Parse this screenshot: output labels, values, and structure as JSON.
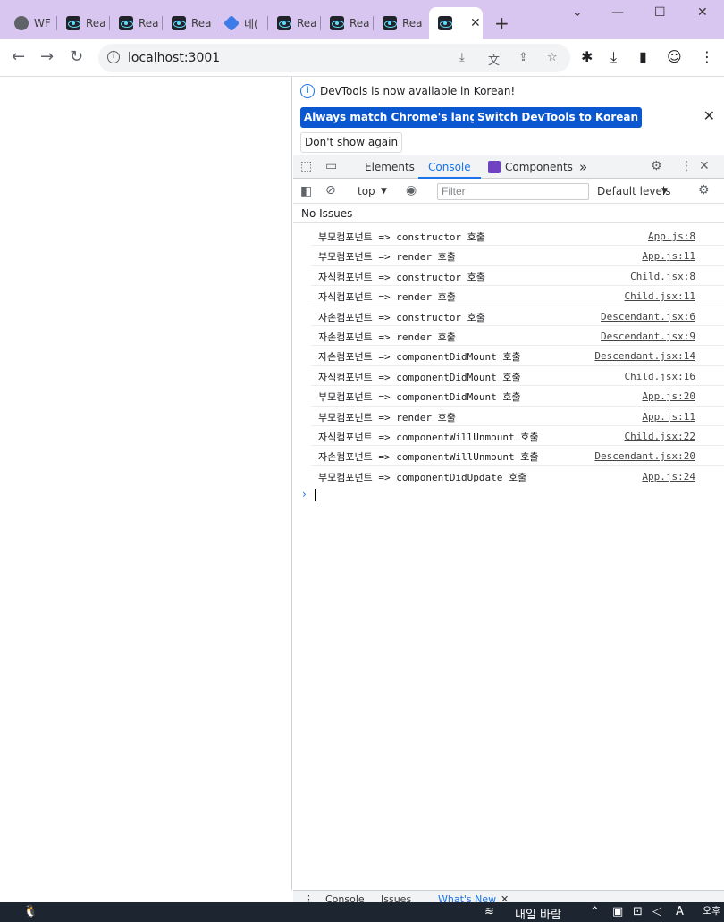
{
  "tabs": [
    {
      "label": "WF",
      "icon": "globe-icon"
    },
    {
      "label": "Rea",
      "icon": "react-icon"
    },
    {
      "label": "Rea",
      "icon": "react-icon"
    },
    {
      "label": "Rea",
      "icon": "react-icon"
    },
    {
      "label": "네(",
      "icon": "cube-icon"
    },
    {
      "label": "Rea",
      "icon": "react-icon"
    },
    {
      "label": "Rea",
      "icon": "react-icon"
    },
    {
      "label": "Rea",
      "icon": "react-icon"
    }
  ],
  "active_tab": {
    "icon": "react-icon",
    "close": "✕"
  },
  "new_tab": "+",
  "window_controls": {
    "minimize": "—",
    "maximize": "☐",
    "close": "✕",
    "dropdown": "⌄"
  },
  "address": {
    "url": "localhost:3001"
  },
  "infobar": {
    "message": "DevTools is now available in Korean!",
    "match_button": "Always match Chrome's language",
    "switch_button": "Switch DevTools to Korean",
    "dont_show": "Don't show again"
  },
  "devtools_tabs": {
    "elements": "Elements",
    "console": "Console",
    "components": "Components",
    "more": "»"
  },
  "console_toolbar": {
    "context": "top",
    "filter_placeholder": "Filter",
    "levels": "Default levels"
  },
  "issues": "No Issues",
  "logs": [
    {
      "msg": "부모컴포넌트 => constructor 호출",
      "src": "App.js:8"
    },
    {
      "msg": "부모컴포넌트 => render 호출",
      "src": "App.js:11"
    },
    {
      "msg": "자식컴포넌트 => constructor 호출",
      "src": "Child.jsx:8"
    },
    {
      "msg": "자식컴포넌트 => render 호출",
      "src": "Child.jsx:11"
    },
    {
      "msg": "자손컴포넌트 => constructor 호출",
      "src": "Descendant.jsx:6"
    },
    {
      "msg": "자손컴포넌트 => render 호출",
      "src": "Descendant.jsx:9"
    },
    {
      "msg": "자손컴포넌트 => componentDidMount 호출",
      "src": "Descendant.jsx:14"
    },
    {
      "msg": "자식컴포넌트 => componentDidMount 호출",
      "src": "Child.jsx:16"
    },
    {
      "msg": "부모컴포넌트 => componentDidMount 호출",
      "src": "App.js:20"
    },
    {
      "msg": "부모컴포넌트 => render 호출",
      "src": "App.js:11"
    },
    {
      "msg": "자식컴포넌트 => componentWillUnmount 호출",
      "src": "Child.jsx:22"
    },
    {
      "msg": "자손컴포넌트 => componentWillUnmount 호출",
      "src": "Descendant.jsx:20"
    },
    {
      "msg": "부모컴포넌트 => componentDidUpdate 호출",
      "src": "App.js:24"
    }
  ],
  "prompt": "›",
  "drawer": {
    "console": "Console",
    "issues": "Issues",
    "whats_new": "What's New"
  },
  "taskbar": {
    "weather": "내일 바람",
    "ime": "A",
    "time": "오후"
  }
}
